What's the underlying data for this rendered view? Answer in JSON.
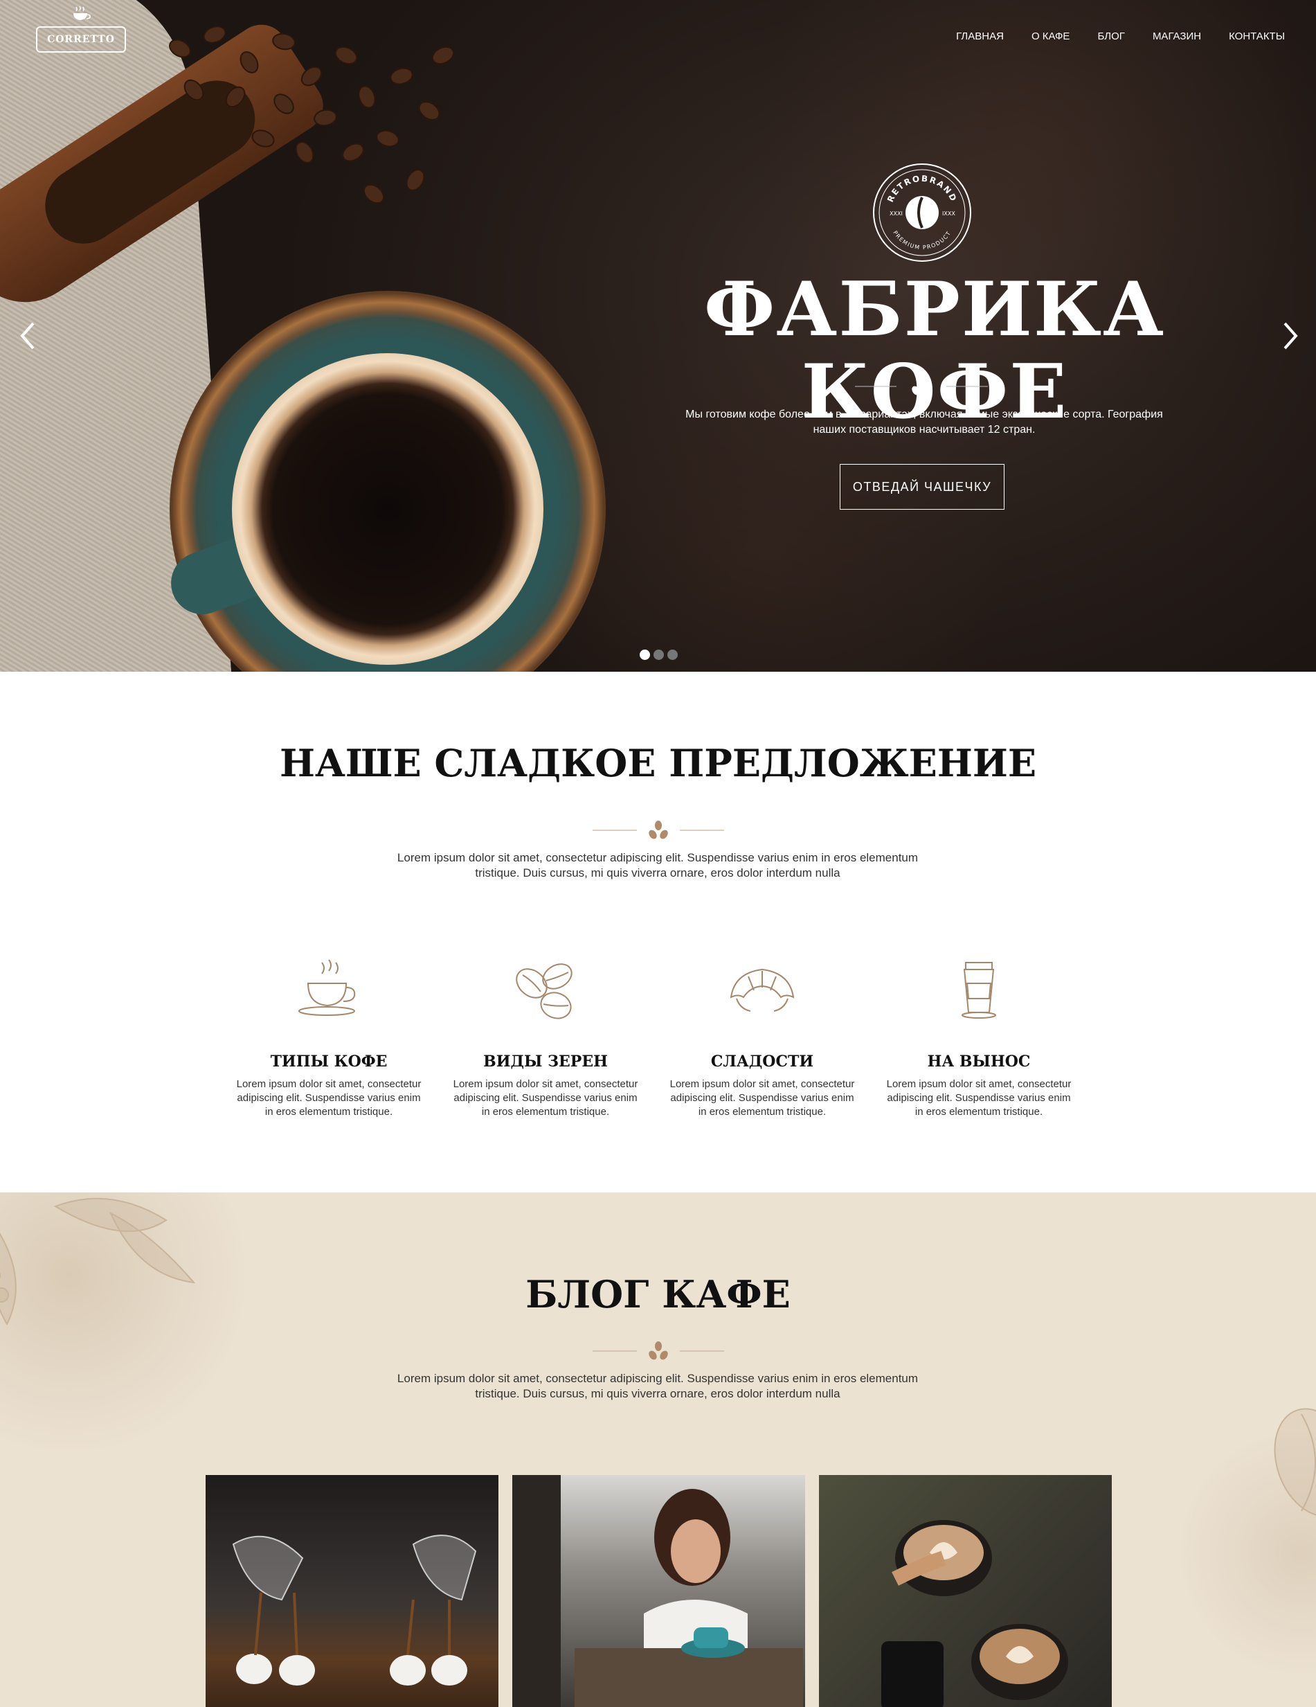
{
  "header": {
    "logo_text": "CORRETTO",
    "nav": [
      "ГЛАВНАЯ",
      "О КАФЕ",
      "БЛОГ",
      "МАГАЗИН",
      "КОНТАКТЫ"
    ]
  },
  "hero": {
    "badge_top": "RETROBRAND",
    "badge_bottom": "PREMIUM PRODUCT",
    "badge_left": "XXXI",
    "badge_right": "IXXX",
    "title": "ФАБРИКА КОФЕ",
    "text": "Мы готовим кофе более чем в 30 вариантах, включая самые экзотические сорта. География наших поставщиков насчитывает 12 стран.",
    "button": "ОТВЕДАЙ ЧАШЕЧКУ",
    "slides_count": 3,
    "active_slide": 1
  },
  "offer": {
    "title": "НАШЕ СЛАДКОЕ ПРЕДЛОЖЕНИЕ",
    "text": "Lorem ipsum dolor sit amet, consectetur adipiscing elit. Suspendisse varius enim in eros elementum tristique. Duis cursus, mi quis viverra ornare, eros dolor interdum nulla",
    "features": [
      {
        "icon": "coffee-cup-icon",
        "title": "ТИПЫ КОФЕ",
        "text": "Lorem ipsum dolor sit amet, consectetur adipiscing elit. Suspendisse varius enim in eros elementum tristique."
      },
      {
        "icon": "coffee-beans-icon",
        "title": "ВИДЫ ЗЕРЕН",
        "text": "Lorem ipsum dolor sit amet, consectetur adipiscing elit. Suspendisse varius enim in eros elementum tristique."
      },
      {
        "icon": "croissant-icon",
        "title": "СЛАДОСТИ",
        "text": "Lorem ipsum dolor sit amet, consectetur adipiscing elit. Suspendisse varius enim in eros elementum tristique."
      },
      {
        "icon": "takeaway-cup-icon",
        "title": "НА ВЫНОС",
        "text": "Lorem ipsum dolor sit amet, consectetur adipiscing elit. Suspendisse varius enim in eros elementum tristique."
      }
    ]
  },
  "blog": {
    "title": "БЛОГ КАФЕ",
    "text": "Lorem ipsum dolor sit amet, consectetur adipiscing elit. Suspendisse varius enim in eros elementum tristique. Duis cursus, mi quis viverra ornare, eros dolor interdum nulla"
  },
  "colors": {
    "accent": "#b08a69",
    "hero_bg": "#2a201c",
    "blog_bg": "#ece2d2"
  }
}
